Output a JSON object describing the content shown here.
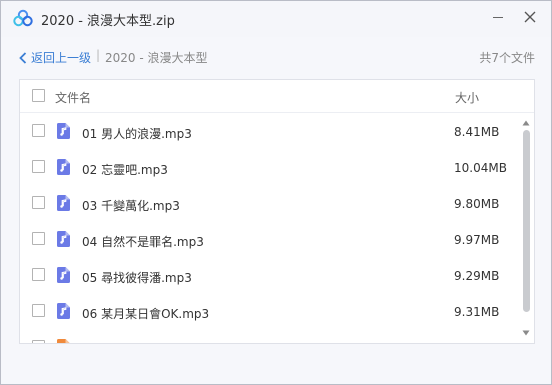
{
  "window": {
    "title": "2020 - 浪漫大本型.zip",
    "accent_color": "#3b7ed4"
  },
  "nav": {
    "back_label": "返回上一级",
    "separator": "|",
    "current_folder": "2020 - 浪漫大本型",
    "file_count": "共7个文件"
  },
  "table": {
    "col_name": "文件名",
    "col_size": "大小",
    "files": [
      {
        "name": "01 男人的浪漫.mp3",
        "size": "8.41MB",
        "icon": "music-file-icon"
      },
      {
        "name": "02 忘靈吧.mp3",
        "size": "10.04MB",
        "icon": "music-file-icon"
      },
      {
        "name": "03 千變萬化.mp3",
        "size": "9.80MB",
        "icon": "music-file-icon"
      },
      {
        "name": "04 自然不是罪名.mp3",
        "size": "9.97MB",
        "icon": "music-file-icon"
      },
      {
        "name": "05 尋找彼得潘.mp3",
        "size": "9.29MB",
        "icon": "music-file-icon"
      },
      {
        "name": "06 某月某日會OK.mp3",
        "size": "9.31MB",
        "icon": "music-file-icon"
      },
      {
        "name": "",
        "size": "",
        "icon": "file-icon"
      }
    ]
  }
}
